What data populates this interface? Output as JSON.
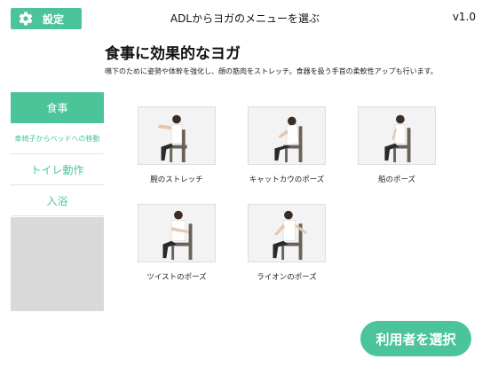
{
  "header": {
    "settings_label": "設定",
    "title": "ADLからヨガのメニューを選ぶ",
    "version": "v1.0"
  },
  "main": {
    "title": "食事に効果的なヨガ",
    "description": "嚥下のために姿勢や体幹を強化し、顔の筋肉をストレッチ。食器を扱う手首の柔軟性アップも行います。"
  },
  "sidebar": {
    "items": [
      {
        "label": "食事"
      },
      {
        "label": "車椅子からベッドへの移動"
      },
      {
        "label": "トイレ動作"
      },
      {
        "label": "入浴"
      }
    ]
  },
  "poses": [
    {
      "label": "腕のストレッチ"
    },
    {
      "label": "キャットカウのポーズ"
    },
    {
      "label": "船のポーズ"
    },
    {
      "label": "ツイストのポーズ"
    },
    {
      "label": "ライオンのポーズ"
    }
  ],
  "footer": {
    "select_user_label": "利用者を選択"
  },
  "colors": {
    "accent": "#4cc49a",
    "sidebar_blank": "#d9d9d9"
  }
}
